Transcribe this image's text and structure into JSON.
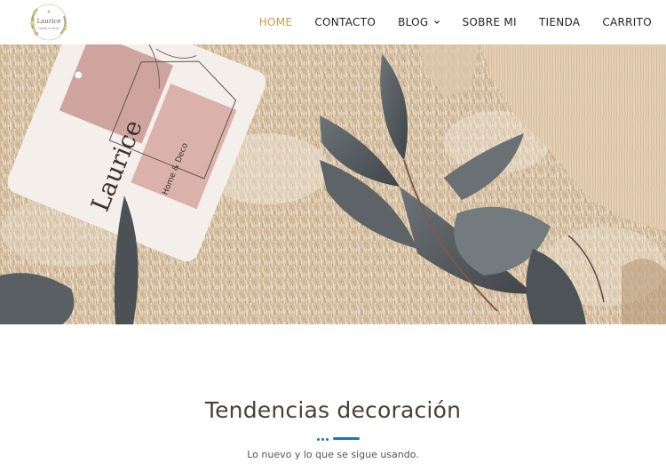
{
  "header": {
    "logo": {
      "text": "Laurice",
      "sub": "home & deco"
    },
    "nav": [
      {
        "label": "HOME",
        "active": true
      },
      {
        "label": "CONTACTO",
        "active": false
      },
      {
        "label": "BLOG",
        "active": false,
        "dropdown": true
      },
      {
        "label": "SOBRE MI",
        "active": false
      },
      {
        "label": "TIENDA",
        "active": false
      },
      {
        "label": "CARRITO",
        "active": false
      }
    ]
  },
  "hero": {
    "tag_title": "Laurice",
    "tag_subtitle": "Home & Deco"
  },
  "section": {
    "title": "Tendencias decoración",
    "subtitle": "Lo nuevo y lo que se sigue usando."
  },
  "colors": {
    "accent": "#c89a4a",
    "divider": "#1e73be",
    "title": "#4a4038"
  }
}
